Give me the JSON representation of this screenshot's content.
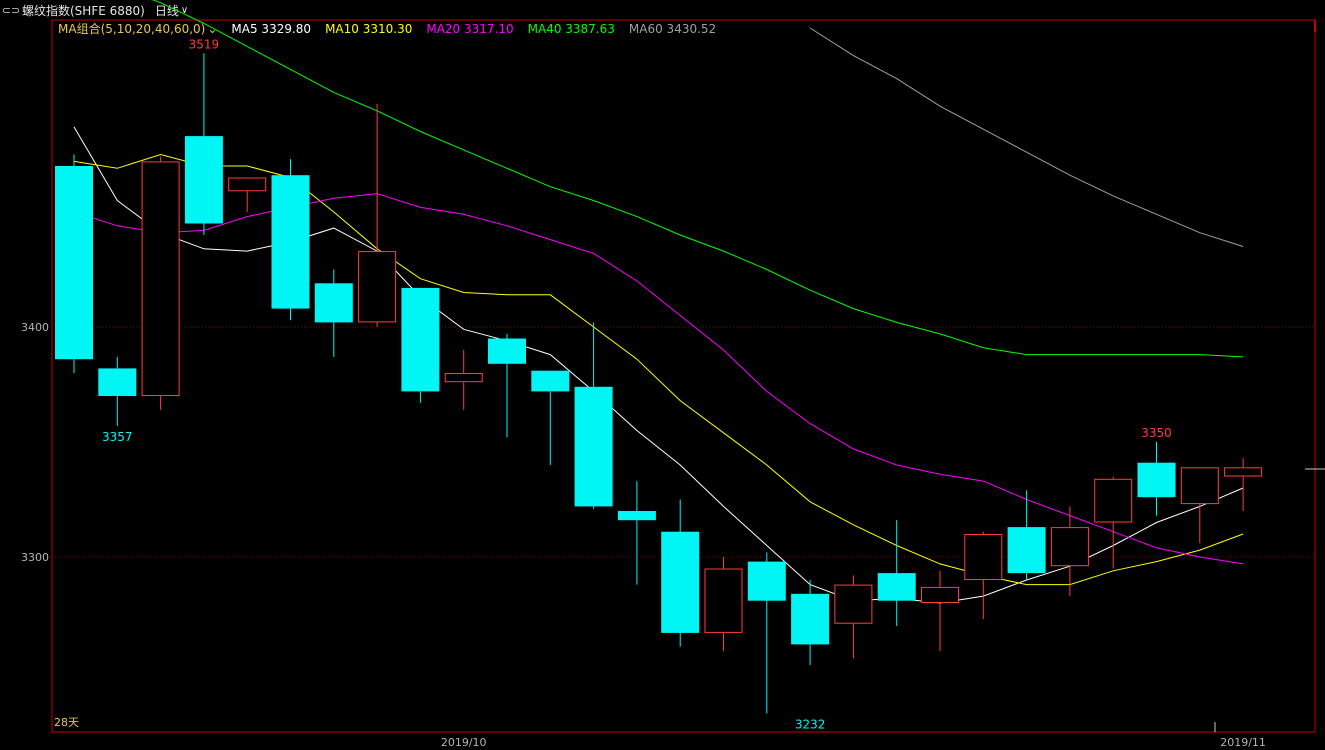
{
  "header": {
    "instrument": "螺纹指数(SHFE 6880)",
    "period": "日线",
    "link_icon": "link-icon",
    "dropdown_icon": "chevron-down-icon"
  },
  "legend": {
    "ma_group": "MA组合(5,10,20,40,60,0)",
    "items": [
      {
        "label": "MA5 3329.80",
        "color": "#ffffff"
      },
      {
        "label": "MA10 3310.30",
        "color": "#ffff00"
      },
      {
        "label": "MA20 3317.10",
        "color": "#ff00ff"
      },
      {
        "label": "MA40 3387.63",
        "color": "#00ff00"
      },
      {
        "label": "MA60 3430.52",
        "color": "#a0a0a0"
      }
    ]
  },
  "colors": {
    "up": "#ff3c3c",
    "down": "#00f5f5",
    "frame": "#c80000",
    "grid": "#7a0000",
    "axis_text": "#b4b4b4"
  },
  "footer": {
    "days_label": "28天"
  },
  "chart_data": {
    "type": "candlestick",
    "ylim": [
      3225,
      3545
    ],
    "yticks": [
      3300,
      3400
    ],
    "xlabels": [
      {
        "index": 9,
        "label": "2019/10"
      },
      {
        "index": 27,
        "label": "2019/11"
      }
    ],
    "annotations": [
      {
        "index": 3,
        "value": 3519,
        "label": "3519",
        "pos": "above",
        "color": "#ff3c3c"
      },
      {
        "index": 1,
        "value": 3357,
        "label": "3357",
        "pos": "below",
        "color": "#00f5f5"
      },
      {
        "index": 17,
        "value": 3232,
        "label": "3232",
        "pos": "below",
        "color": "#00f5f5"
      },
      {
        "index": 25,
        "value": 3350,
        "label": "3350",
        "pos": "above",
        "color": "#ff3c3c"
      }
    ],
    "candles": [
      {
        "o": 3470,
        "h": 3475,
        "l": 3380,
        "c": 3386
      },
      {
        "o": 3382,
        "h": 3387,
        "l": 3357,
        "c": 3370
      },
      {
        "o": 3370,
        "h": 3474,
        "l": 3364,
        "c": 3472
      },
      {
        "o": 3483,
        "h": 3519,
        "l": 3440,
        "c": 3445
      },
      {
        "o": 3459,
        "h": 3463,
        "l": 3450,
        "c": 3465
      },
      {
        "o": 3466,
        "h": 3473,
        "l": 3403,
        "c": 3408
      },
      {
        "o": 3419,
        "h": 3425,
        "l": 3387,
        "c": 3402
      },
      {
        "o": 3402,
        "h": 3497,
        "l": 3400,
        "c": 3433
      },
      {
        "o": 3417,
        "h": 3417,
        "l": 3367,
        "c": 3372
      },
      {
        "o": 3376,
        "h": 3390,
        "l": 3364,
        "c": 3380
      },
      {
        "o": 3395,
        "h": 3397,
        "l": 3352,
        "c": 3384
      },
      {
        "o": 3381,
        "h": 3381,
        "l": 3340,
        "c": 3372
      },
      {
        "o": 3374,
        "h": 3402,
        "l": 3321,
        "c": 3322
      },
      {
        "o": 3320,
        "h": 3333,
        "l": 3288,
        "c": 3316
      },
      {
        "o": 3311,
        "h": 3325,
        "l": 3261,
        "c": 3267
      },
      {
        "o": 3267,
        "h": 3300,
        "l": 3259,
        "c": 3295
      },
      {
        "o": 3298,
        "h": 3302,
        "l": 3232,
        "c": 3281
      },
      {
        "o": 3284,
        "h": 3290,
        "l": 3253,
        "c": 3262
      },
      {
        "o": 3271,
        "h": 3292,
        "l": 3256,
        "c": 3288
      },
      {
        "o": 3293,
        "h": 3316,
        "l": 3270,
        "c": 3281
      },
      {
        "o": 3280,
        "h": 3294,
        "l": 3259,
        "c": 3287
      },
      {
        "o": 3290,
        "h": 3311,
        "l": 3273,
        "c": 3310
      },
      {
        "o": 3313,
        "h": 3329,
        "l": 3290,
        "c": 3293
      },
      {
        "o": 3296,
        "h": 3322,
        "l": 3283,
        "c": 3313
      },
      {
        "o": 3315,
        "h": 3335,
        "l": 3295,
        "c": 3334
      },
      {
        "o": 3341,
        "h": 3350,
        "l": 3318,
        "c": 3326
      },
      {
        "o": 3323,
        "h": 3339,
        "l": 3306,
        "c": 3339
      },
      {
        "o": 3335,
        "h": 3343,
        "l": 3320,
        "c": 3339
      }
    ],
    "series": [
      {
        "name": "MA5",
        "color": "#ffffff",
        "values": [
          3487,
          3455,
          3441,
          3434,
          3433,
          3437,
          3443,
          3433,
          3413,
          3399,
          3394,
          3388,
          3372,
          3355,
          3340,
          3322,
          3305,
          3288,
          3281,
          3282,
          3280,
          3283,
          3290,
          3296,
          3305,
          3315,
          3322,
          3330
        ]
      },
      {
        "name": "MA10",
        "color": "#ffff00",
        "values": [
          3472,
          3469,
          3475,
          3470,
          3470,
          3465,
          3450,
          3434,
          3421,
          3415,
          3414,
          3414,
          3400,
          3386,
          3368,
          3354,
          3340,
          3324,
          3314,
          3305,
          3297,
          3292,
          3288,
          3288,
          3294,
          3298,
          3303,
          3310
        ]
      },
      {
        "name": "MA20",
        "color": "#ff00ff",
        "values": [
          3450,
          3444,
          3441,
          3442,
          3448,
          3452,
          3456,
          3458,
          3452,
          3449,
          3444,
          3438,
          3432,
          3420,
          3405,
          3390,
          3372,
          3358,
          3347,
          3340,
          3336,
          3333,
          3325,
          3318,
          3311,
          3304,
          3300,
          3297
        ]
      },
      {
        "name": "MA40",
        "color": "#00ff00",
        "values": [
          3555,
          3548,
          3541,
          3532,
          3522,
          3512,
          3502,
          3494,
          3485,
          3477,
          3469,
          3461,
          3455,
          3448,
          3440,
          3433,
          3425,
          3416,
          3408,
          3402,
          3397,
          3391,
          3388,
          3388,
          3388,
          3388,
          3388,
          3387
        ]
      },
      {
        "name": "MA60",
        "color": "#a0a0a0",
        "startIndex": 17,
        "values": [
          3530,
          3518,
          3508,
          3496,
          3486,
          3476,
          3466,
          3457,
          3449,
          3441,
          3435
        ]
      }
    ]
  }
}
